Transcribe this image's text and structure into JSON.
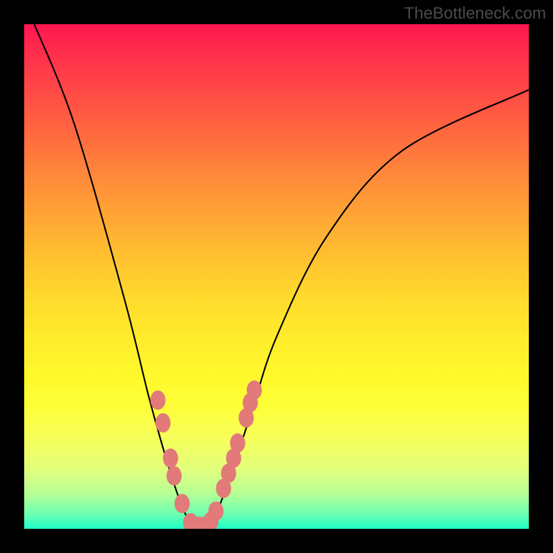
{
  "watermark": "TheBottleneck.com",
  "chart_data": {
    "type": "line",
    "title": "",
    "xlabel": "",
    "ylabel": "",
    "xlim": [
      0,
      100
    ],
    "ylim": [
      0,
      100
    ],
    "gradient_stops": [
      {
        "pos": 0,
        "color": "#ff1751"
      },
      {
        "pos": 50,
        "color": "#ffd92d"
      },
      {
        "pos": 100,
        "color": "#1dffc7"
      }
    ],
    "series": [
      {
        "name": "curve",
        "x": [
          2,
          10,
          20,
          25,
          30,
          33,
          35,
          37,
          40,
          45,
          50,
          60,
          75,
          100
        ],
        "y": [
          100,
          80,
          45,
          25,
          8,
          1,
          0,
          1,
          8,
          23,
          38,
          58,
          75,
          87
        ]
      }
    ],
    "markers": {
      "name": "dots",
      "color": "#e27a7a",
      "points": [
        {
          "x": 26.5,
          "y": 25.5
        },
        {
          "x": 27.5,
          "y": 21
        },
        {
          "x": 29.0,
          "y": 14
        },
        {
          "x": 29.7,
          "y": 10.5
        },
        {
          "x": 31.3,
          "y": 5
        },
        {
          "x": 33.0,
          "y": 1.2
        },
        {
          "x": 34.5,
          "y": 0.5
        },
        {
          "x": 35.5,
          "y": 0.5
        },
        {
          "x": 37.0,
          "y": 1.5
        },
        {
          "x": 38.0,
          "y": 3.5
        },
        {
          "x": 39.5,
          "y": 8
        },
        {
          "x": 40.5,
          "y": 11
        },
        {
          "x": 41.5,
          "y": 14
        },
        {
          "x": 42.3,
          "y": 17
        },
        {
          "x": 44.0,
          "y": 22
        },
        {
          "x": 44.8,
          "y": 25
        },
        {
          "x": 45.6,
          "y": 27.5
        }
      ]
    }
  }
}
